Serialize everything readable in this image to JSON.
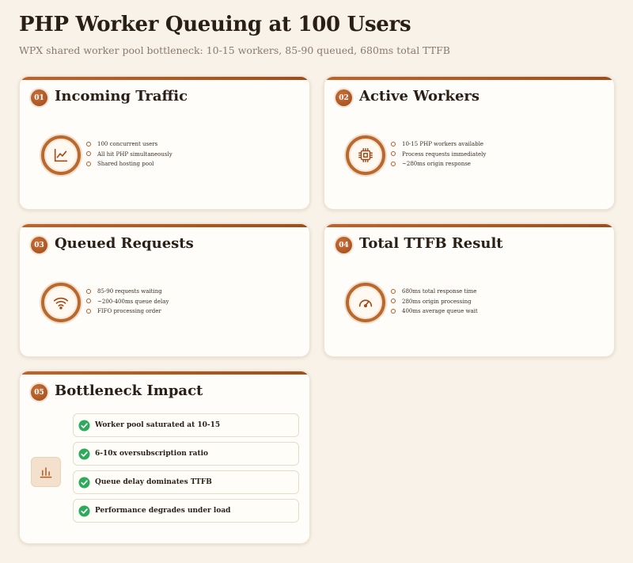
{
  "header": {
    "title": "PHP Worker Queuing at 100 Users",
    "subtitle": "WPX shared worker pool bottleneck: 10-15 workers, 85-90 queued, 680ms total TTFB"
  },
  "cards": [
    {
      "number": "01",
      "title": "Incoming Traffic",
      "icon": "line-chart-icon",
      "bullets": [
        "100 concurrent users",
        "All hit PHP simultaneously",
        "Shared hosting pool"
      ]
    },
    {
      "number": "02",
      "title": "Active Workers",
      "icon": "cpu-chip-icon",
      "bullets": [
        "10-15 PHP workers available",
        "Process requests immediately",
        "~280ms origin response"
      ]
    },
    {
      "number": "03",
      "title": "Queued Requests",
      "icon": "wifi-icon",
      "bullets": [
        "85-90 requests waiting",
        "~200-400ms queue delay",
        "FIFO processing order"
      ]
    },
    {
      "number": "04",
      "title": "Total TTFB Result",
      "icon": "speedometer-icon",
      "bullets": [
        "680ms total response time",
        "280ms origin processing",
        "400ms average queue wait"
      ]
    },
    {
      "number": "05",
      "title": "Bottleneck Impact",
      "icon": "bar-chart-icon",
      "checks": [
        "Worker pool saturated at 10-15",
        "6-10x oversubscription ratio",
        "Queue delay dominates TTFB",
        "Performance degrades under load"
      ]
    }
  ],
  "colors": {
    "accent": "#b25b22",
    "check": "#2eaa5c",
    "background": "#f8f2e8"
  }
}
